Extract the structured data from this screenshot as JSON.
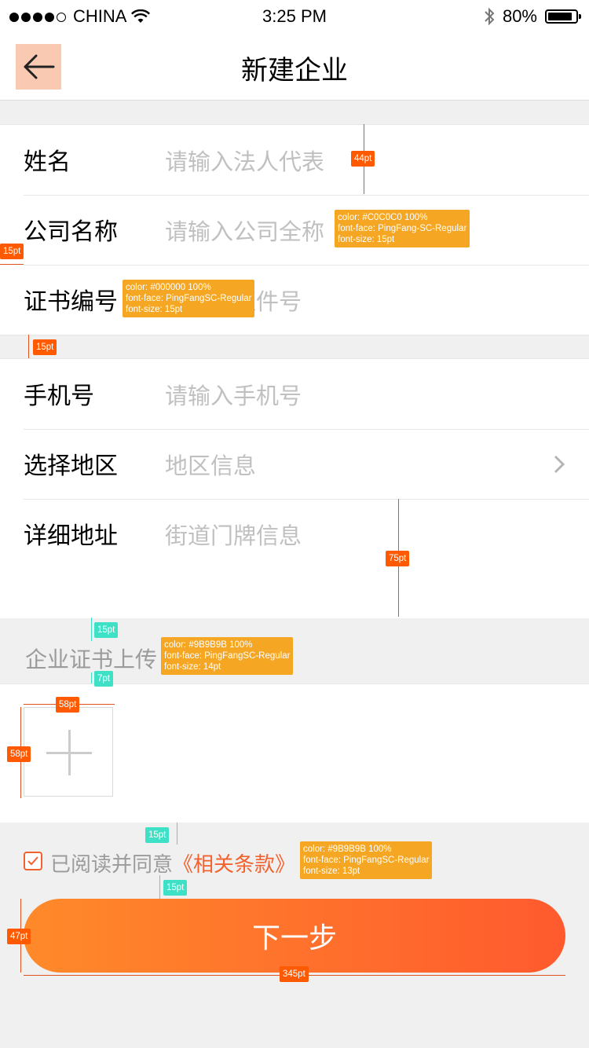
{
  "status_bar": {
    "carrier": "CHINA",
    "time": "3:25 PM",
    "battery": "80%"
  },
  "nav": {
    "title": "新建企业"
  },
  "form_group1": [
    {
      "label": "姓名",
      "placeholder": "请输入法人代表"
    },
    {
      "label": "公司名称",
      "placeholder": "请输入公司全称"
    },
    {
      "label": "证书编号",
      "placeholder": "请输入证件号"
    }
  ],
  "form_group2": [
    {
      "label": "手机号",
      "placeholder": "请输入手机号"
    },
    {
      "label": "选择地区",
      "placeholder": "地区信息"
    },
    {
      "label": "详细地址",
      "placeholder": "街道门牌信息"
    }
  ],
  "upload": {
    "title": "企业证书上传"
  },
  "agreement": {
    "text": "已阅读并同意",
    "link": "《相关条款》",
    "checked": true
  },
  "next_button": {
    "label": "下一步"
  },
  "annotations": {
    "spec_placeholder": [
      "color: #C0C0C0 100%",
      "font-face: PingFang-SC-Regular",
      "font-size: 15pt"
    ],
    "spec_label": [
      "color: #000000 100%",
      "font-face: PingFangSC-Regular",
      "font-size: 15pt"
    ],
    "spec_upload": [
      "color: #9B9B9B 100%",
      "font-face: PingFangSC-Regular",
      "font-size: 14pt"
    ],
    "spec_agree": [
      "color: #9B9B9B 100%",
      "font-face: PingFangSC-Regular",
      "font-size: 13pt"
    ],
    "dim_row": "44pt",
    "dim_margin": "15pt",
    "dim_gap": "15pt",
    "dim_address": "75pt",
    "dim_upload_top": "15pt",
    "dim_upload_bottom": "7pt",
    "dim_box_w": "58pt",
    "dim_box_h": "58pt",
    "dim_agree_top": "15pt",
    "dim_agree_bottom": "15pt",
    "dim_btn_h": "47pt",
    "dim_btn_w": "345pt"
  },
  "colors": {
    "accent": "#f2622e",
    "button_start": "#ff8a2a",
    "button_end": "#ff5a2e",
    "placeholder": "#c0c0c0",
    "muted": "#9b9b9b"
  }
}
